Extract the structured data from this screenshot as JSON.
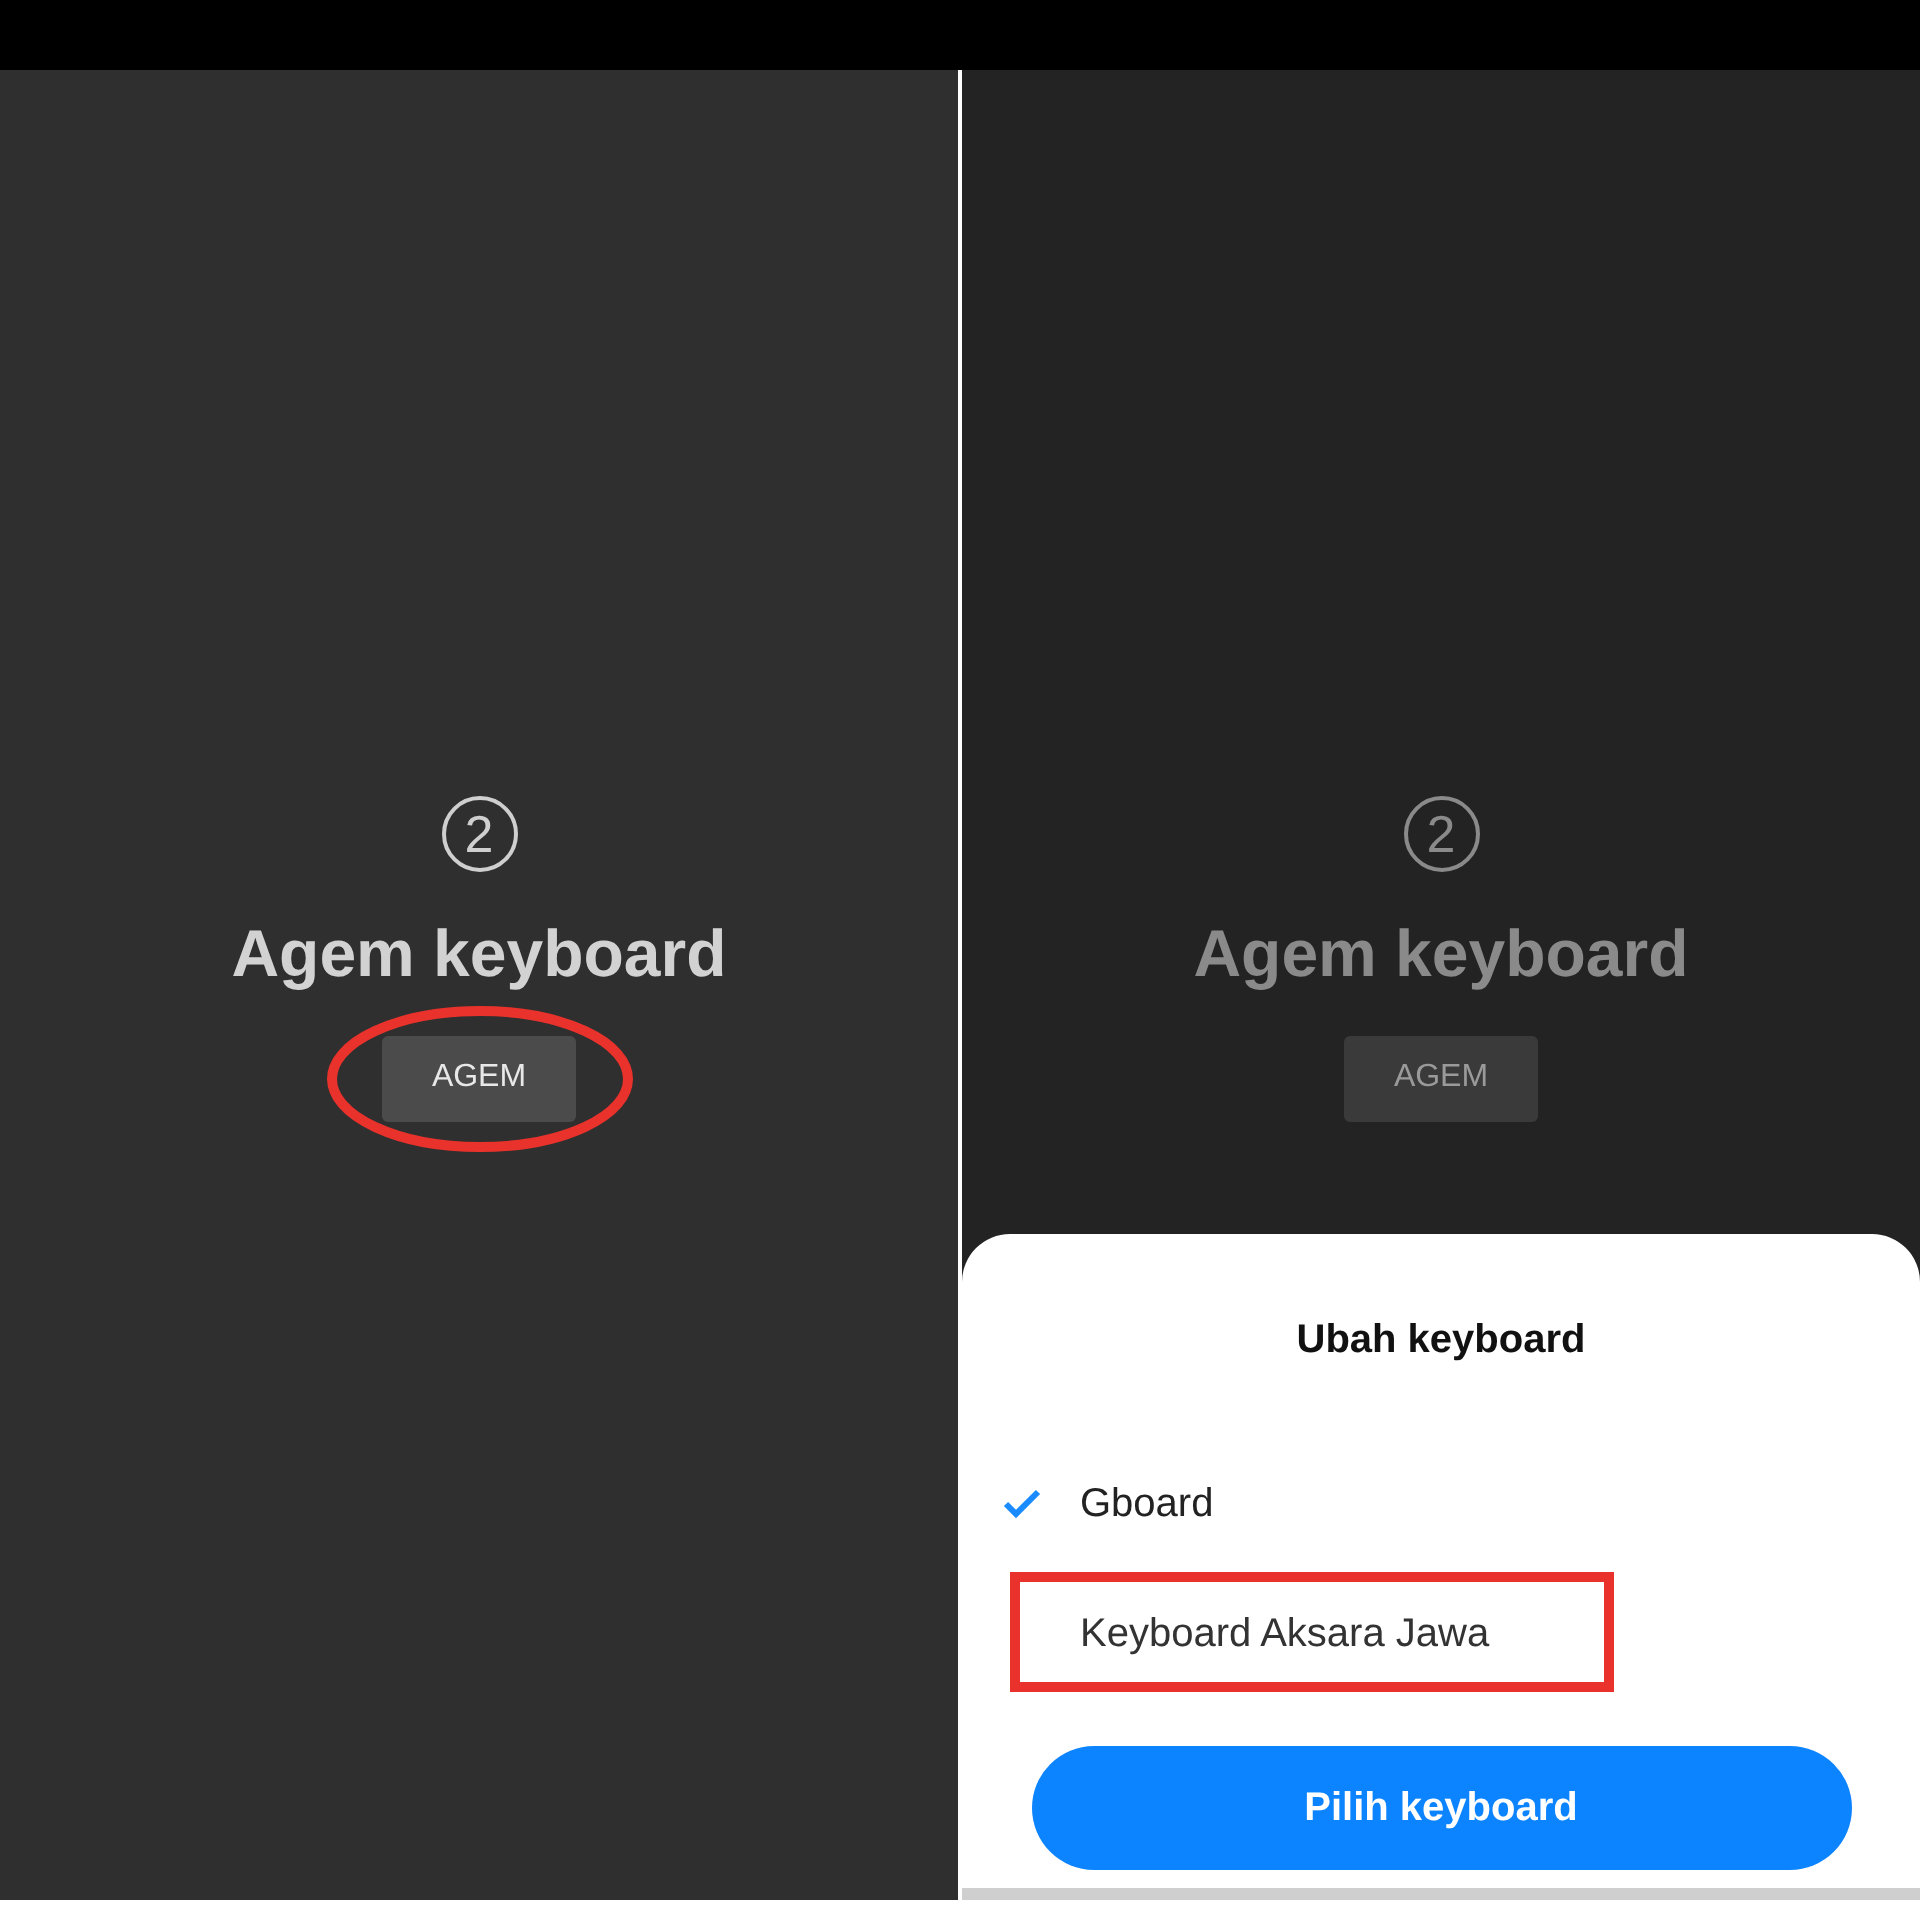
{
  "screens": [
    {
      "step": "2",
      "title": "Agem keyboard",
      "dimmed": false,
      "button": {
        "label": "AGEM",
        "highlighted": true
      }
    },
    {
      "step": "2",
      "title": "Agem keyboard",
      "dimmed": true,
      "button": {
        "label": "AGEM",
        "highlighted": false
      },
      "sheet": {
        "title": "Ubah keyboard",
        "options": [
          {
            "label": "Gboard",
            "selected": true,
            "highlighted": false
          },
          {
            "label": "Keyboard Aksara Jawa",
            "selected": false,
            "highlighted": true
          }
        ],
        "button": "Pilih keyboard"
      }
    }
  ]
}
